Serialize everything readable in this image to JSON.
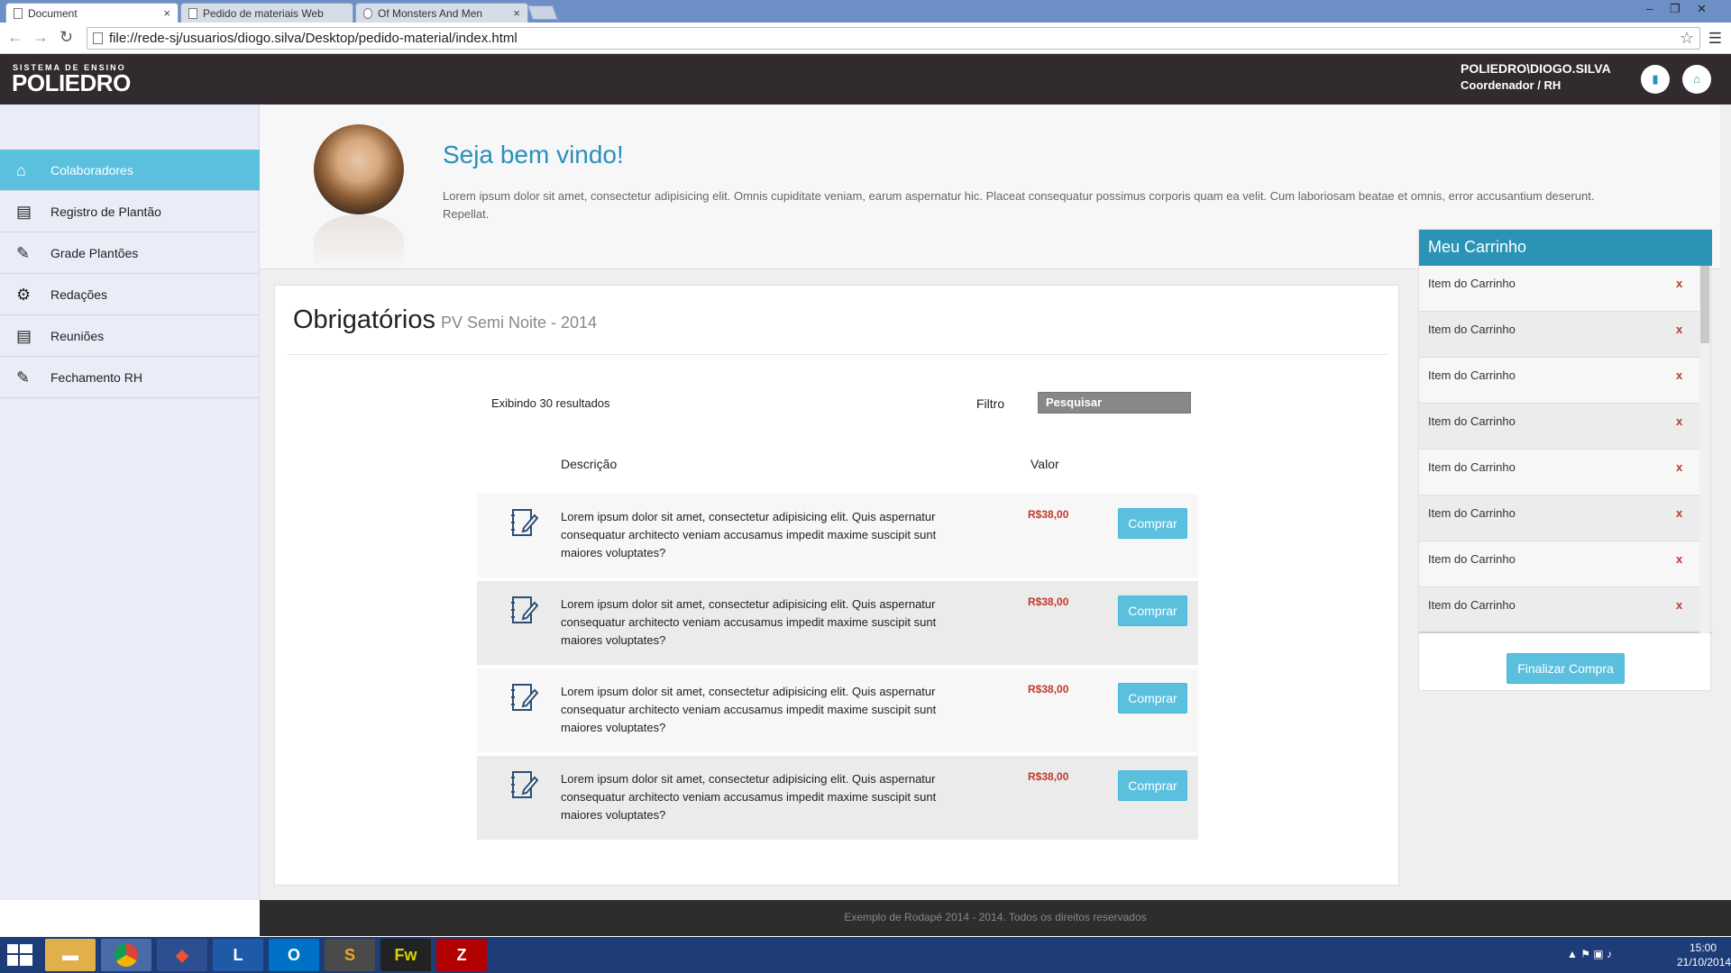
{
  "browser": {
    "tabs": [
      {
        "title": "Document",
        "active": true
      },
      {
        "title": "Pedido de materiais Web",
        "active": false
      },
      {
        "title": "Of Monsters And Men",
        "active": false
      }
    ],
    "address": "file://rede-sj/usuarios/diogo.silva/Desktop/pedido-material/index.html"
  },
  "header": {
    "logo_small": "SISTEMA DE ENSINO",
    "logo_big": "POLIEDRO",
    "user_name": "POLIEDRO\\DIOGO.SILVA",
    "user_role": "Coordenador / RH"
  },
  "sidebar": {
    "items": [
      {
        "label": "Colaboradores",
        "icon": "home-icon",
        "active": true
      },
      {
        "label": "Registro de Plantão",
        "icon": "book-icon",
        "active": false
      },
      {
        "label": "Grade Plantões",
        "icon": "pencil-icon",
        "active": false
      },
      {
        "label": "Redações",
        "icon": "gears-icon",
        "active": false
      },
      {
        "label": "Reuniões",
        "icon": "book-icon",
        "active": false
      },
      {
        "label": "Fechamento RH",
        "icon": "pencil-icon",
        "active": false
      }
    ]
  },
  "welcome": {
    "title": "Seja bem vindo!",
    "text": "Lorem ipsum dolor sit amet, consectetur adipisicing elit. Omnis cupiditate veniam, earum aspernatur hic. Placeat consequatur possimus corporis quam ea velit. Cum laboriosam beatae et omnis, error accusantium deserunt. Repellat."
  },
  "main": {
    "title": "Obrigatórios",
    "subtitle": "PV Semi Noite - 2014",
    "result_count": "Exibindo 30 resultados",
    "filter_label": "Filtro",
    "filter_placeholder": "Pesquisar",
    "col_desc": "Descrição",
    "col_value": "Valor",
    "products": [
      {
        "desc": "Lorem ipsum dolor sit amet, consectetur adipisicing elit. Quis aspernatur consequatur architecto veniam accusamus impedit maxime suscipit sunt maiores voluptates?",
        "price": "R$38,00",
        "button": "Comprar"
      },
      {
        "desc": "Lorem ipsum dolor sit amet, consectetur adipisicing elit. Quis aspernatur consequatur architecto veniam accusamus impedit maxime suscipit sunt maiores voluptates?",
        "price": "R$38,00",
        "button": "Comprar"
      },
      {
        "desc": "Lorem ipsum dolor sit amet, consectetur adipisicing elit. Quis aspernatur consequatur architecto veniam accusamus impedit maxime suscipit sunt maiores voluptates?",
        "price": "R$38,00",
        "button": "Comprar"
      },
      {
        "desc": "Lorem ipsum dolor sit amet, consectetur adipisicing elit. Quis aspernatur consequatur architecto veniam accusamus impedit maxime suscipit sunt maiores voluptates?",
        "price": "R$38,00",
        "button": "Comprar"
      }
    ]
  },
  "cart": {
    "title": "Meu Carrinho",
    "items": [
      {
        "label": "Item do Carrinho",
        "remove": "x"
      },
      {
        "label": "Item do Carrinho",
        "remove": "x"
      },
      {
        "label": "Item do Carrinho",
        "remove": "x"
      },
      {
        "label": "Item do Carrinho",
        "remove": "x"
      },
      {
        "label": "Item do Carrinho",
        "remove": "x"
      },
      {
        "label": "Item do Carrinho",
        "remove": "x"
      },
      {
        "label": "Item do Carrinho",
        "remove": "x"
      },
      {
        "label": "Item do Carrinho",
        "remove": "x"
      }
    ],
    "finish_button": "Finalizar Compra"
  },
  "footer": {
    "text": "Exemplo de Rodapé 2014 - 2014. Todos os direitos reservados"
  },
  "taskbar": {
    "time": "15:00",
    "date": "21/10/2014"
  },
  "colors": {
    "accent": "#5bc0de",
    "header_bg": "#312a2f",
    "cart_header": "#2a93b6",
    "price": "#c0392b"
  }
}
